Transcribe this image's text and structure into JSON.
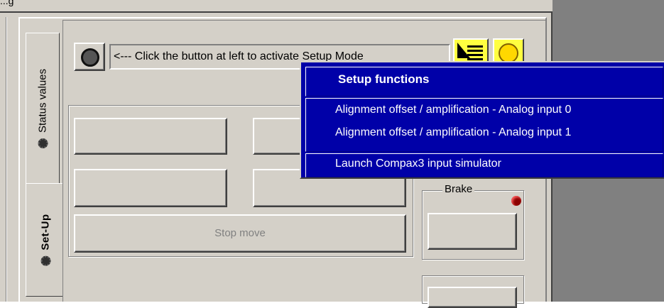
{
  "window": {
    "title_fragment": "...g"
  },
  "tabs": [
    {
      "label": "Status values"
    },
    {
      "label": "Set-Up"
    }
  ],
  "setup": {
    "hint_text": "<--- Click the button at left to activate Setup Mode"
  },
  "buttons": {
    "stop_move": "Stop move"
  },
  "brake": {
    "label": "Brake",
    "led_color": "#8b0000"
  },
  "context_menu": {
    "title": "Setup functions",
    "items": [
      "Alignment offset / amplification - Analog input 0",
      "Alignment offset / amplification - Analog input 1",
      "Launch Compax3 input simulator"
    ]
  },
  "colors": {
    "panel": "#d4d0c8",
    "menu_bg": "#0000a8",
    "icon_bg": "#ffff40",
    "background": "#808080"
  }
}
